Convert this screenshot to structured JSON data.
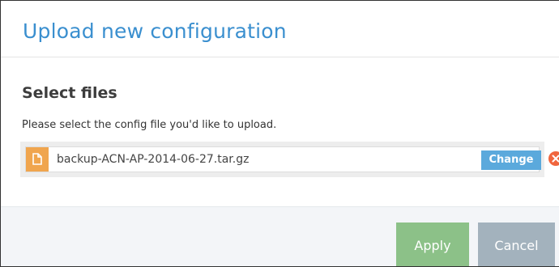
{
  "dialog": {
    "title": "Upload new configuration",
    "section_title": "Select files",
    "hint": "Please select the config file you'd like to upload."
  },
  "file": {
    "icon": "file-icon",
    "name": "backup-ACN-AP-2014-06-27.tar.gz",
    "change_label": "Change",
    "remove_icon": "remove-icon"
  },
  "footer": {
    "apply_label": "Apply",
    "cancel_label": "Cancel"
  },
  "colors": {
    "title": "#3a8fcf",
    "file_icon_bg": "#f0a54e",
    "change_button": "#5ba9dc",
    "remove_icon": "#f0663e",
    "apply_button": "#8cc188",
    "cancel_button": "#a3b2bd",
    "footer_bg": "#f3f5f8"
  }
}
